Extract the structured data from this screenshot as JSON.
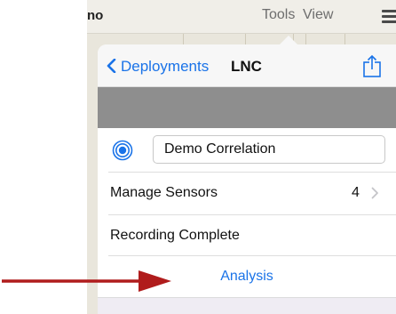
{
  "toolbar": {
    "title_fragment": "no",
    "tools_label": "Tools",
    "view_label": "View",
    "menu_icon": "hamburger-icon"
  },
  "popover": {
    "nav": {
      "back_label": "Deployments",
      "back_icon": "chevron-left-icon",
      "title": "LNC",
      "share_icon": "share-icon"
    },
    "name_row": {
      "icon": "target-icon",
      "value": "Demo Correlation"
    },
    "sensors_row": {
      "label": "Manage Sensors",
      "count": "4",
      "icon": "chevron-right-icon"
    },
    "recording_row": {
      "label": "Recording Complete"
    },
    "analysis_row": {
      "label": "Analysis"
    }
  },
  "colors": {
    "accent": "#1a73e8",
    "arrow": "#b01c1c",
    "gray_band": "#8e8e8e"
  }
}
